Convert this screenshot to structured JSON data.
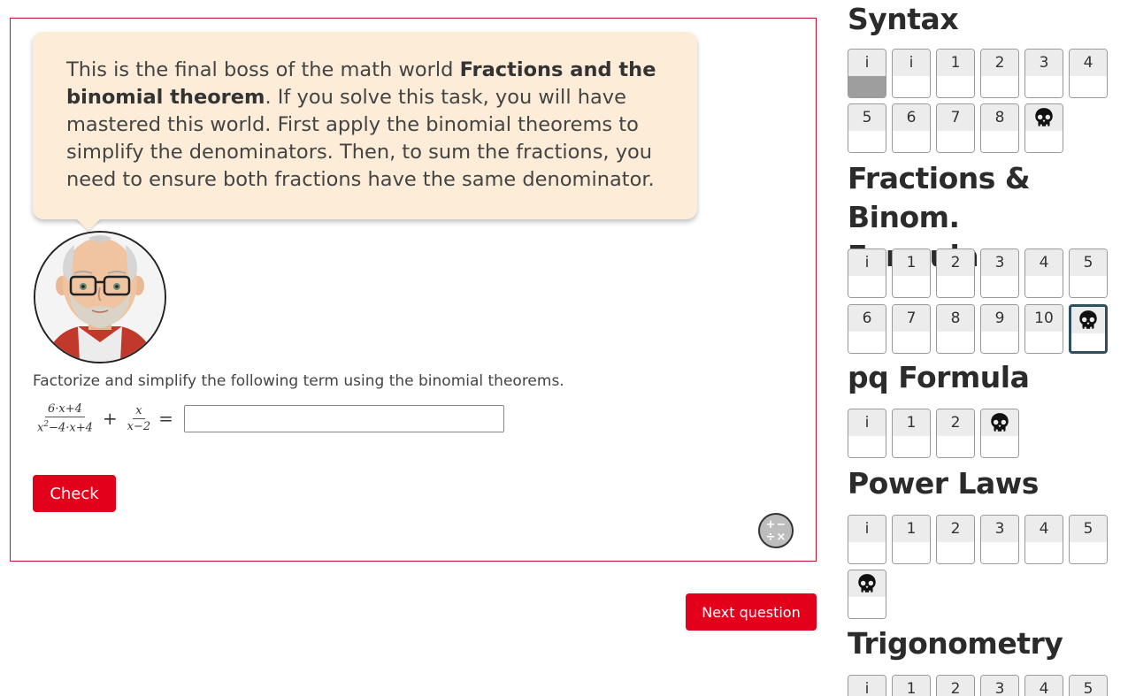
{
  "bubble": {
    "text_before": "This is the final boss of the math world ",
    "world_name": "Fractions and the binomial theorem",
    "text_after": ". If you solve this task, you will have mastered this world. First apply the binomial theorems to simplify the denominators. Then, to sum the fractions, you need to ensure both fractions have the same denominator."
  },
  "task": {
    "instruction": "Factorize and simplify the following term using the binomial theorems.",
    "frac1_num": "6·x+4",
    "frac1_den_a": "x",
    "frac1_den_exp": "2",
    "frac1_den_b": "−4·x+4",
    "plus": "+",
    "frac2_num": "x",
    "frac2_den": "x−2",
    "equals": "=",
    "answer_value": "",
    "check_label": "Check",
    "calc_symbols": [
      "+",
      "−",
      "÷",
      "×"
    ]
  },
  "next_label": "Next question",
  "sidebar": {
    "sections": [
      {
        "title": "Syntax",
        "rows": [
          [
            "i",
            "i",
            "1",
            "2",
            "3",
            "4"
          ],
          [
            "5",
            "6",
            "7",
            "8",
            "boss"
          ]
        ]
      },
      {
        "title_line1": "Fractions & Binom.",
        "title_line2": "Formulas",
        "rows": [
          [
            "i",
            "1",
            "2",
            "3",
            "4",
            "5"
          ],
          [
            "6",
            "7",
            "8",
            "9",
            "10",
            "boss"
          ]
        ]
      },
      {
        "title": "pq Formula",
        "rows": [
          [
            "i",
            "1",
            "2",
            "boss"
          ]
        ]
      },
      {
        "title": "Power Laws",
        "rows": [
          [
            "i",
            "1",
            "2",
            "3",
            "4",
            "5"
          ],
          [
            "boss"
          ]
        ]
      },
      {
        "title": "Trigonometry",
        "rows": [
          [
            "i",
            "1",
            "2",
            "3",
            "4",
            "5"
          ]
        ]
      }
    ]
  },
  "colors": {
    "accent": "#e2001a",
    "panel_border": "#c8102e",
    "bubble_bg": "#fcecd8",
    "current_tile": "#2f4f5f",
    "completed_bar": "#9e9e9e"
  },
  "icons": {
    "boss": "skull-icon",
    "calculator": "calculator-icon"
  }
}
